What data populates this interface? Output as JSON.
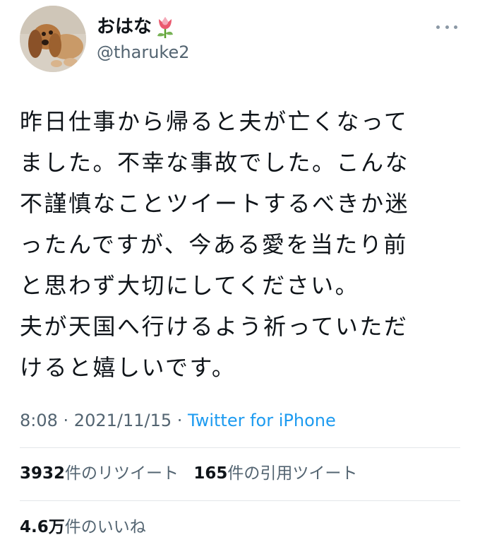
{
  "user": {
    "display_name": "おはな",
    "handle": "@tharuke2",
    "emoji_icon": "tulip-icon"
  },
  "tweet": {
    "lines": [
      "昨日仕事から帰ると夫が亡くなって",
      "ました。不幸な事故でした。こんな",
      "不謹慎なことツイートするべきか迷",
      "ったんですが、今ある愛を当たり前",
      "と思わず大切にしてください。",
      "夫が天国へ行けるよう祈っていただ",
      "けると嬉しいです。"
    ]
  },
  "meta": {
    "time": "8:08",
    "separator": " · ",
    "date": "2021/11/15",
    "separator2": " · ",
    "source": "Twitter for iPhone"
  },
  "stats": {
    "retweets_count": "3932",
    "retweets_label": "件のリツイート",
    "quotes_count": "165",
    "quotes_label": "件の引用ツイート",
    "likes_count": "4.6万",
    "likes_label": "件のいいね"
  },
  "colors": {
    "text": "#0f1419",
    "secondary": "#536471",
    "link": "#1d9bf0",
    "divider": "#e3e6e9"
  }
}
